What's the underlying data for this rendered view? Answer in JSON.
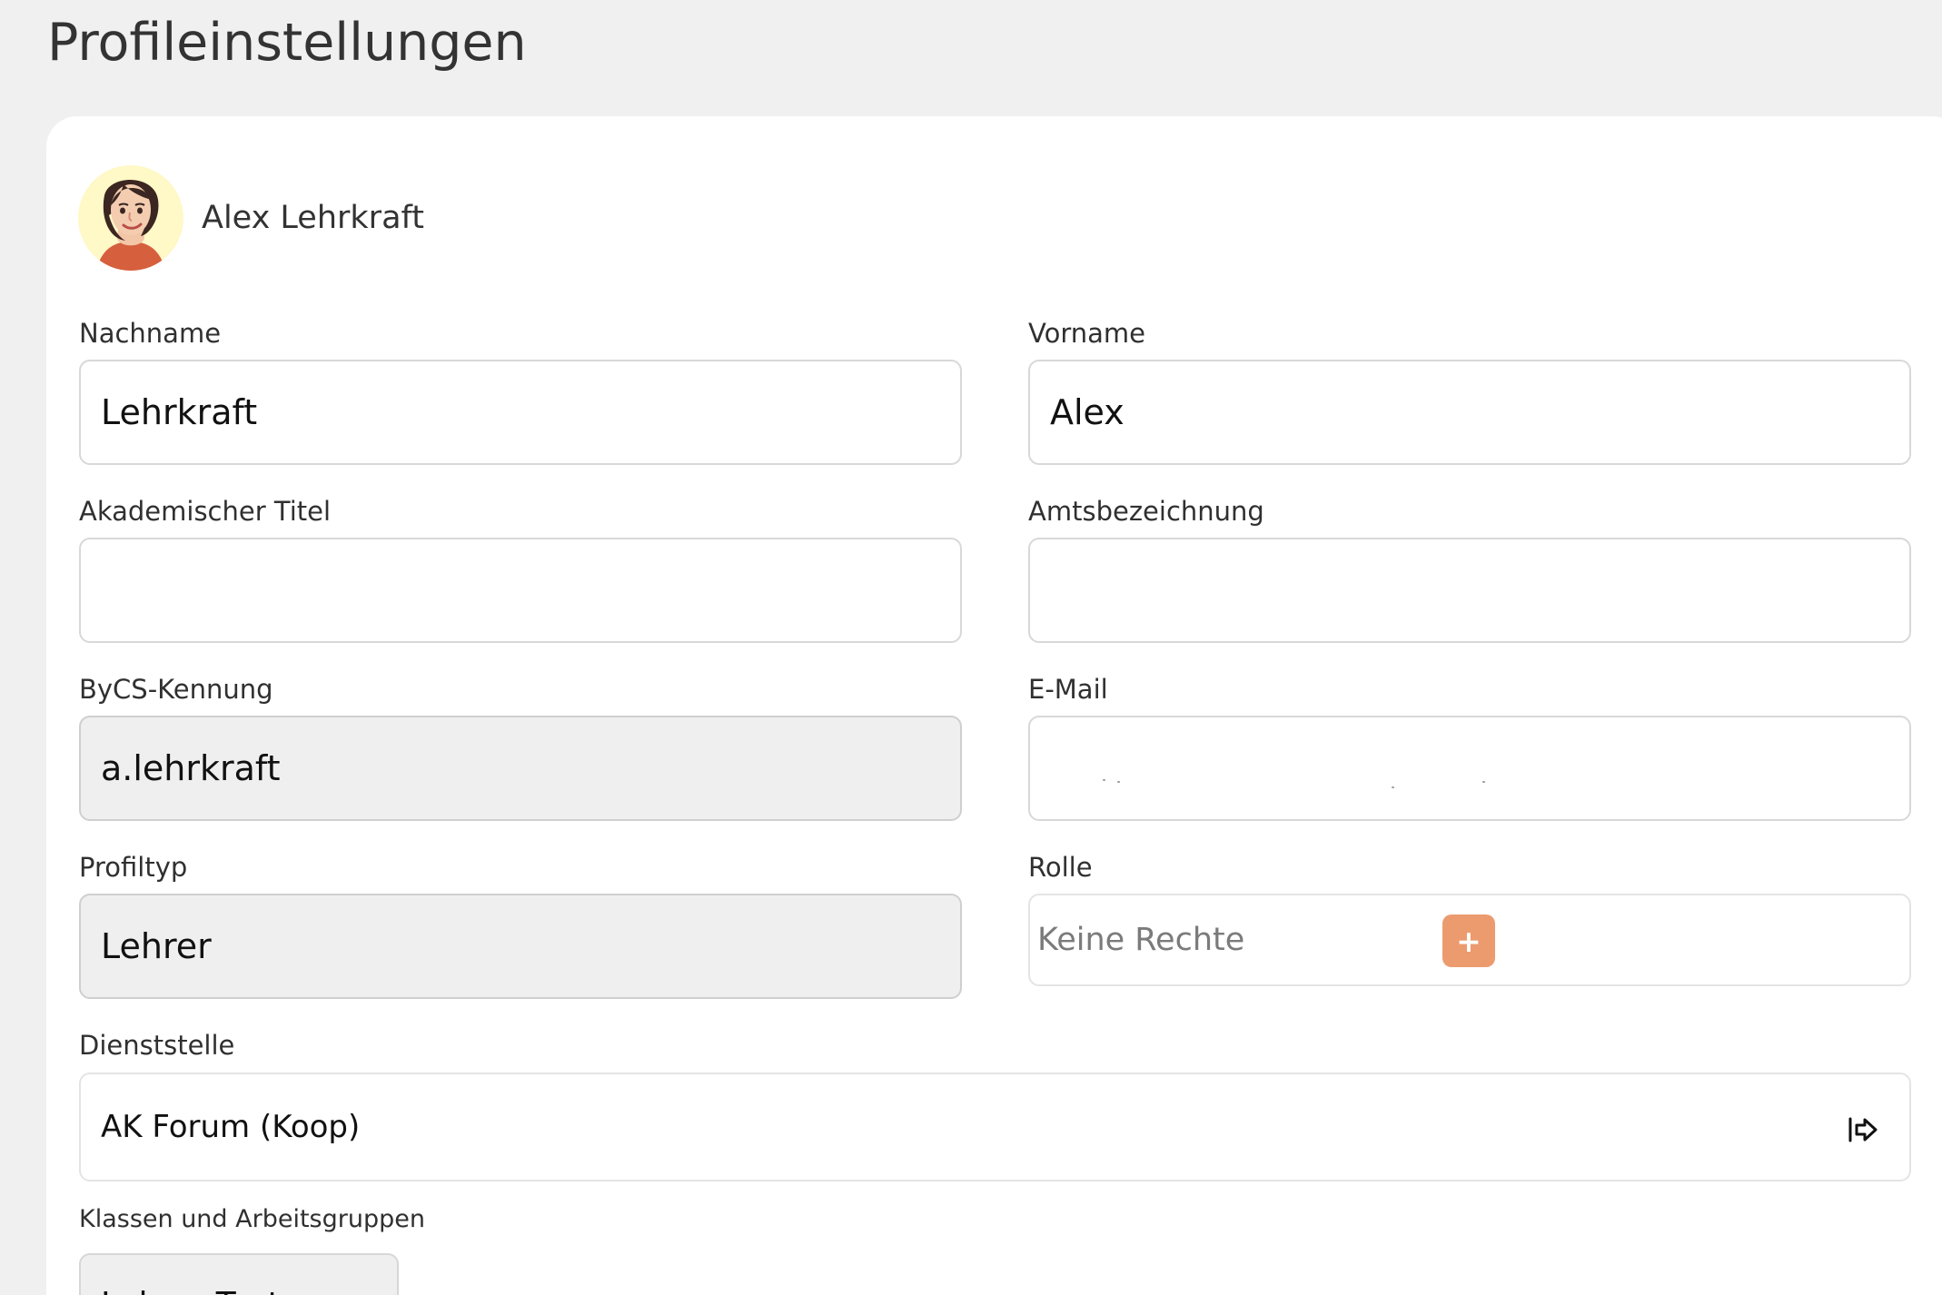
{
  "page": {
    "title": "Profileinstellungen"
  },
  "profile": {
    "name": "Alex Lehrkraft",
    "avatar_icon": "teacher-avatar-icon"
  },
  "fields": {
    "nachname": {
      "label": "Nachname",
      "value": "Lehrkraft"
    },
    "vorname": {
      "label": "Vorname",
      "value": "Alex"
    },
    "akademischer_titel": {
      "label": "Akademischer Titel",
      "value": ""
    },
    "amtsbezeichnung": {
      "label": "Amtsbezeichnung",
      "value": ""
    },
    "bycs_kennung": {
      "label": "ByCS-Kennung",
      "value": "a.lehrkraft"
    },
    "email": {
      "label": "E-Mail",
      "value": ""
    },
    "profiltyp": {
      "label": "Profiltyp",
      "value": "Lehrer"
    },
    "rolle": {
      "label": "Rolle",
      "placeholder": "Keine Rechte",
      "add_button": "+"
    },
    "dienststelle": {
      "label": "Dienststelle",
      "value": "AK Forum (Koop)",
      "action_icon": "open-link-icon"
    },
    "klassen": {
      "label": "Klassen und Arbeitsgruppen",
      "chip": "Lehrer Test"
    }
  },
  "colors": {
    "background": "#f0f0f0",
    "card": "#ffffff",
    "readonly": "#efefef",
    "accent": "#ec9b6f"
  }
}
